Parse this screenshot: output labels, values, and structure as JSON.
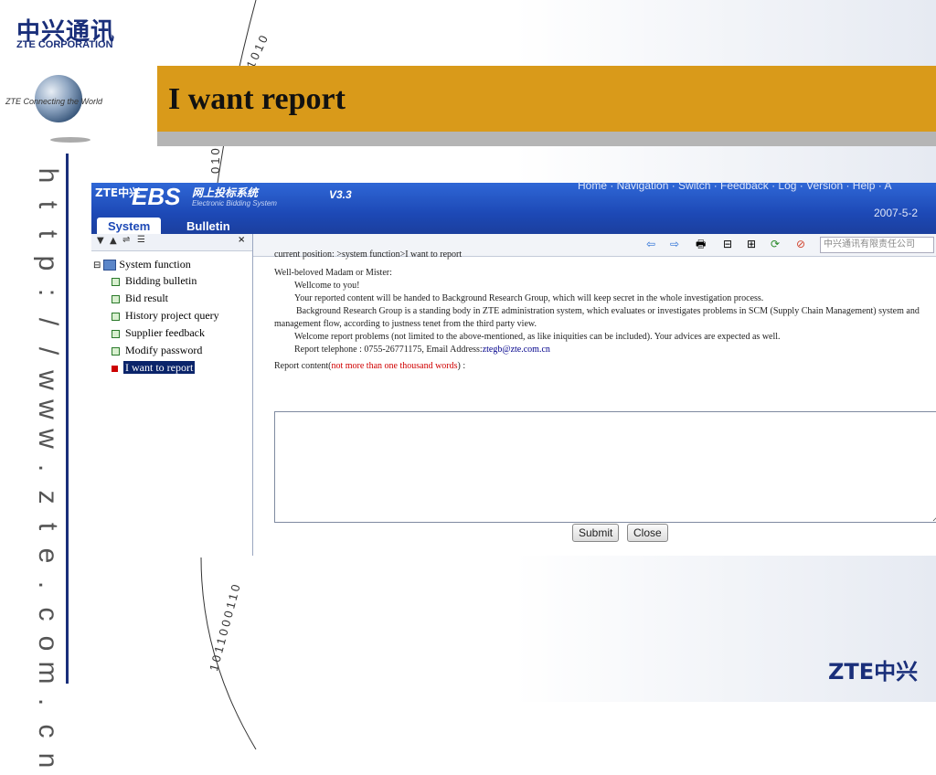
{
  "slide": {
    "logo_cn": "中兴通讯",
    "logo_en": "ZTE CORPORATION",
    "tagline": "ZTE Connecting the World",
    "title": "I want report",
    "url_chars": [
      "h",
      "t",
      "t",
      "p",
      ":",
      "/",
      "/",
      "w",
      "w",
      "w",
      ".",
      "z",
      "t",
      "e",
      ".",
      "c",
      "o",
      "m",
      ".",
      "c",
      "n"
    ],
    "binary_top": "01010",
    "binary_mid": "010",
    "binary_bottom": "1011000110",
    "footer_logo": "ZTE中兴",
    "colors": {
      "accent": "#d99a1a",
      "brand": "#1a2f7a"
    }
  },
  "app": {
    "header": {
      "logo_small": "ZTE中兴",
      "name": "EBS",
      "name_cn": "网上投标系统",
      "name_sub": "Electronic Bidding System",
      "version": "V3.3",
      "nav": "Home · Navigation · Switch · Feedback · Log · Version · Help · A",
      "date": "2007-5-2"
    },
    "tabs": [
      {
        "label": "System"
      },
      {
        "label": "Bulletin"
      }
    ],
    "left_toolbar": {
      "icons": [
        "down-arrow-icon",
        "up-arrow-icon",
        "tree-icon",
        "list-icon"
      ],
      "close": "×"
    },
    "tree": {
      "root": "System function",
      "items": [
        {
          "label": "Bidding bulletin",
          "selected": false
        },
        {
          "label": "Bid result",
          "selected": false
        },
        {
          "label": "History project query",
          "selected": false
        },
        {
          "label": "Supplier feedback",
          "selected": false
        },
        {
          "label": "Modify password",
          "selected": false
        },
        {
          "label": "I want to report",
          "selected": true
        }
      ]
    },
    "right_toolbar": {
      "icons": [
        "back-arrow-icon",
        "forward-arrow-icon",
        "print-icon",
        "minimize-icon",
        "maximize-icon",
        "refresh-icon",
        "stop-icon"
      ],
      "company": "中兴通讯有限责任公司"
    },
    "content": {
      "position": "current position: >system function>I want to report",
      "greeting": "Well-beloved Madam or Mister:",
      "p1": "Wellcome to you!",
      "p2": "Your reported content will be handed to Background Research Group, which will keep secret in the whole investigation process.",
      "p3": "Background Research Group is a standing body in ZTE administration system, which evaluates or investigates problems in SCM (Supply Chain Management) system and management flow, according to justness tenet from the third party view.",
      "p4": "Welcome report problems (not limited to the above-mentioned, as like iniquities can be included). Your advices are expected as well.",
      "p5_prefix": "Report telephone : 0755-26771175, Email Address:",
      "email": "ztegb@zte.com.cn",
      "report_label_prefix": "Report content(",
      "report_label_red": "not more than one thousand words",
      "report_label_suffix": ") :",
      "textarea_value": ""
    },
    "buttons": {
      "submit": "Submit",
      "close": "Close"
    }
  }
}
